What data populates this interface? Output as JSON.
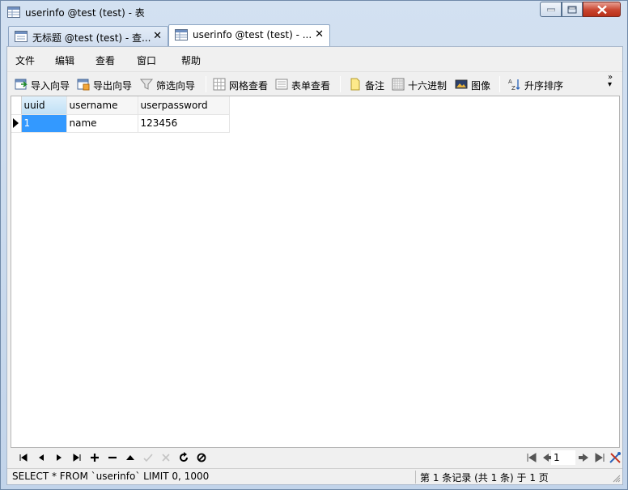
{
  "window": {
    "title": "userinfo @test (test) - 表"
  },
  "tabs": [
    {
      "label": "无标题 @test (test) - 查...",
      "active": false
    },
    {
      "label": "userinfo @test (test) - ...",
      "active": true
    }
  ],
  "menu": [
    "文件",
    "编辑",
    "查看",
    "窗口",
    "帮助"
  ],
  "toolbar": {
    "import": "导入向导",
    "export": "导出向导",
    "filter": "筛选向导",
    "grid_view": "网格查看",
    "form_view": "表单查看",
    "memo": "备注",
    "hex": "十六进制",
    "image": "图像",
    "sort": "升序排序",
    "more": "»"
  },
  "table": {
    "columns": [
      "uuid",
      "username",
      "userpassword"
    ],
    "rows": [
      [
        "1",
        "name",
        "123456"
      ]
    ]
  },
  "nav": {
    "page": "1"
  },
  "status": {
    "sql": "SELECT * FROM `userinfo` LIMIT 0, 1000",
    "records": "第 1 条记录 (共 1 条) 于 1 页"
  },
  "colors": {
    "accent": "#3399ff",
    "close": "#c9452f"
  }
}
